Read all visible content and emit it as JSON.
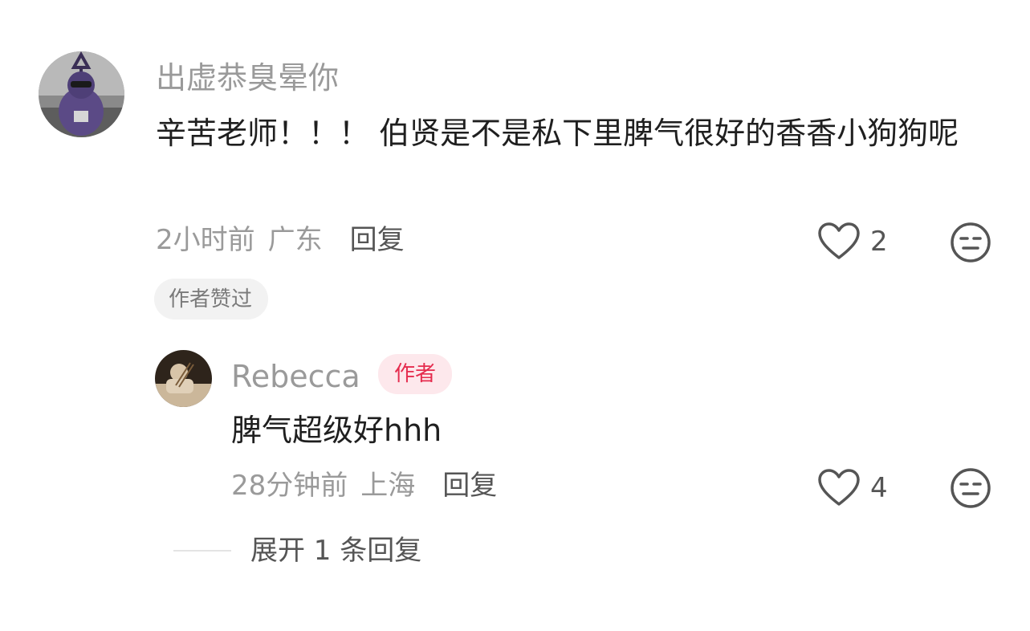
{
  "comment": {
    "username": "出虚恭臭晕你",
    "text": "辛苦老师！！！ 伯贤是不是私下里脾气很好的香香小狗狗呢",
    "time": "2小时前",
    "location": "广东",
    "reply_label": "回复",
    "like_count": "2",
    "badge": "作者赞过"
  },
  "reply": {
    "username": "Rebecca",
    "author_tag": "作者",
    "text": "脾气超级好hhh",
    "time": "28分钟前",
    "location": "上海",
    "reply_label": "回复",
    "like_count": "4"
  },
  "expand_label": "展开 1 条回复",
  "colors": {
    "author_tag_bg": "#fde8ec",
    "author_tag_text": "#e52c4e",
    "muted_text": "#9a9a9a"
  }
}
